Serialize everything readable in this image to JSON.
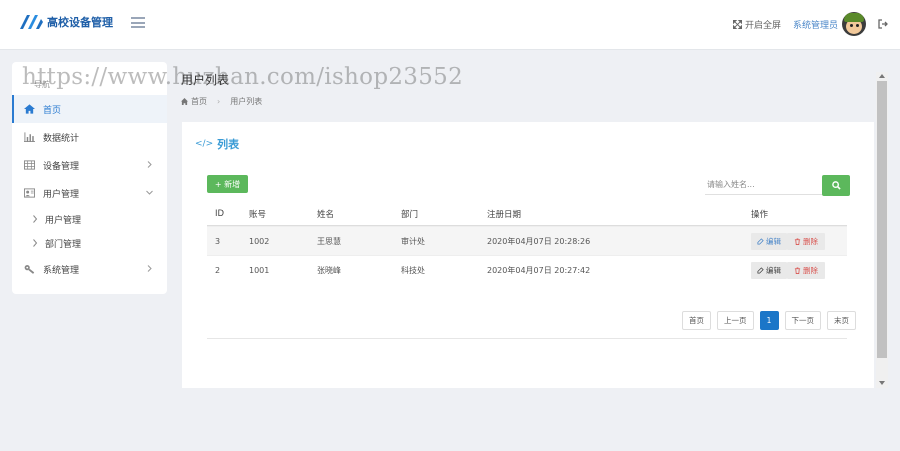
{
  "header": {
    "app_name": "高校设备管理",
    "fullscreen_label": "开启全屏",
    "user_name": "系统管理员"
  },
  "sidebar": {
    "heading": "导航",
    "items": [
      {
        "label": "首页",
        "icon": "home-icon"
      },
      {
        "label": "数据统计",
        "icon": "bar-chart-icon"
      },
      {
        "label": "设备管理",
        "icon": "table-icon"
      },
      {
        "label": "用户管理",
        "icon": "user-icon"
      },
      {
        "label": "用户管理",
        "icon": "chevron-right-icon"
      },
      {
        "label": "部门管理",
        "icon": "chevron-right-icon"
      },
      {
        "label": "系统管理",
        "icon": "wrench-icon"
      }
    ]
  },
  "page": {
    "title": "用户列表",
    "breadcrumb": {
      "home": "首页",
      "current": "用户列表"
    }
  },
  "card": {
    "title": "列表",
    "add_label": "+ 新增",
    "search_placeholder": "请输入姓名..."
  },
  "table": {
    "columns": [
      "ID",
      "账号",
      "姓名",
      "部门",
      "注册日期",
      "操作"
    ],
    "rows": [
      {
        "id": "3",
        "account": "1002",
        "name": "王思慧",
        "dept": "审计处",
        "date": "2020年04月07日 20:28:26"
      },
      {
        "id": "2",
        "account": "1001",
        "name": "张晓峰",
        "dept": "科技处",
        "date": "2020年04月07日 20:27:42"
      }
    ],
    "edit_label": "编辑",
    "delete_label": "删除"
  },
  "pagination": {
    "first": "首页",
    "prev": "上一页",
    "current": "1",
    "next": "下一页",
    "last": "末页"
  },
  "watermark": "https://www.huzhan.com/ishop23552",
  "colors": {
    "accent": "#1b76c8",
    "success": "#5cb85c",
    "danger": "#d9534f",
    "title": "#3a9bd5"
  }
}
